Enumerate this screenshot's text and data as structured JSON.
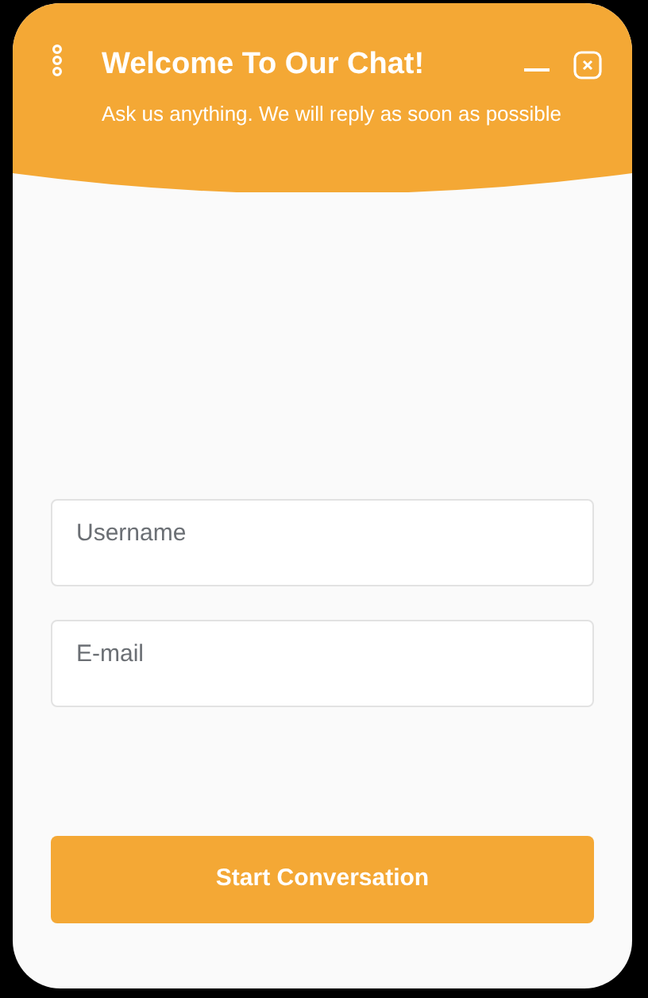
{
  "header": {
    "title": "Welcome To Our Chat!",
    "subtitle": "Ask us anything. We will reply as soon as possible"
  },
  "form": {
    "fields": [
      {
        "placeholder": "Username"
      },
      {
        "placeholder": "E-mail"
      }
    ],
    "submit": "Start Conversation"
  }
}
